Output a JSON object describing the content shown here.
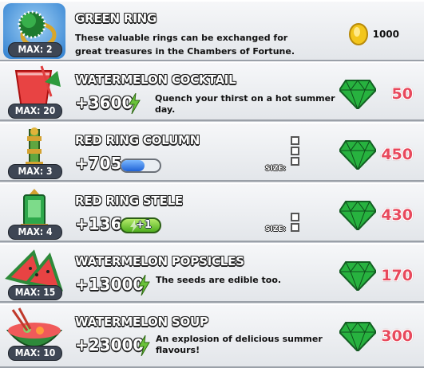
{
  "items": [
    {
      "name": "GREEN RING",
      "max": "MAX: 2",
      "description": "These valuable rings can be exchanged for great treasures in the Chambers of Fortune.",
      "price": "1000",
      "currency": "coin"
    },
    {
      "name": "WATERMELON COCKTAIL",
      "max": "MAX: 20",
      "value": "+3600",
      "flavor": "Quench your thirst on a hot summer day.",
      "price": "50",
      "currency": "gem"
    },
    {
      "name": "RED RING COLUMN",
      "max": "MAX: 3",
      "value": "+705",
      "progress": 0.6,
      "size_label": "SIZE:",
      "size_cells": 3,
      "price": "450",
      "currency": "gem"
    },
    {
      "name": "RED RING STELE",
      "max": "MAX: 4",
      "value": "+136",
      "energy_bonus": "+1",
      "size_label": "SIZE:",
      "size_cells": 2,
      "price": "430",
      "currency": "gem"
    },
    {
      "name": "WATERMELON POPSICLES",
      "max": "MAX: 15",
      "value": "+13000",
      "flavor": "The seeds are edible too.",
      "price": "170",
      "currency": "gem"
    },
    {
      "name": "WATERMELON SOUP",
      "max": "MAX: 10",
      "value": "+23000",
      "flavor": "An explosion of delicious summer flavours!",
      "price": "300",
      "currency": "gem"
    }
  ],
  "colors": {
    "gem": "#27b23f",
    "price": "#e8495c",
    "coin": "#f3c61c",
    "bar": "#2f6fe0"
  }
}
